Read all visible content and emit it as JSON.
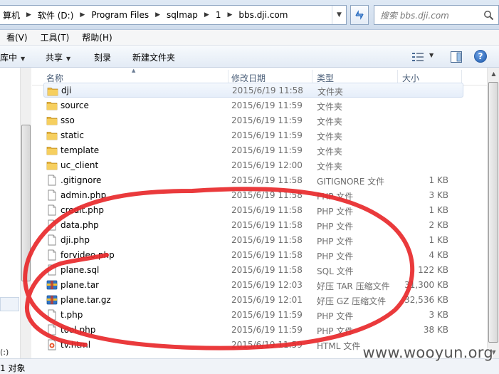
{
  "address": {
    "crumbs": [
      "算机",
      "软件 (D:)",
      "Program Files",
      "sqlmap",
      "1",
      "bbs.dji.com"
    ],
    "search_placeholder": "搜索 bbs.dji.com"
  },
  "menu": [
    "看(V)",
    "工具(T)",
    "帮助(H)"
  ],
  "toolbar": {
    "library_label": "库中",
    "share_label": "共享",
    "burn_label": "刻录",
    "new_folder_label": "新建文件夹",
    "help_label": "?"
  },
  "columns": {
    "name": "名称",
    "date": "修改日期",
    "type": "类型",
    "size": "大小"
  },
  "files": [
    {
      "name": "dji",
      "date": "2015/6/19 11:58",
      "type": "文件夹",
      "size": "",
      "icon": "folder-icon",
      "selected": true
    },
    {
      "name": "source",
      "date": "2015/6/19 11:59",
      "type": "文件夹",
      "size": "",
      "icon": "folder-icon"
    },
    {
      "name": "sso",
      "date": "2015/6/19 11:59",
      "type": "文件夹",
      "size": "",
      "icon": "folder-icon"
    },
    {
      "name": "static",
      "date": "2015/6/19 11:59",
      "type": "文件夹",
      "size": "",
      "icon": "folder-icon"
    },
    {
      "name": "template",
      "date": "2015/6/19 11:59",
      "type": "文件夹",
      "size": "",
      "icon": "folder-icon"
    },
    {
      "name": "uc_client",
      "date": "2015/6/19 12:00",
      "type": "文件夹",
      "size": "",
      "icon": "folder-icon"
    },
    {
      "name": ".gitignore",
      "date": "2015/6/19 11:58",
      "type": "GITIGNORE 文件",
      "size": "1 KB",
      "icon": "file-icon"
    },
    {
      "name": "admin.php",
      "date": "2015/6/19 11:58",
      "type": "PHP 文件",
      "size": "3 KB",
      "icon": "file-icon"
    },
    {
      "name": "credit.php",
      "date": "2015/6/19 11:58",
      "type": "PHP 文件",
      "size": "1 KB",
      "icon": "file-icon"
    },
    {
      "name": "data.php",
      "date": "2015/6/19 11:58",
      "type": "PHP 文件",
      "size": "2 KB",
      "icon": "file-icon"
    },
    {
      "name": "dji.php",
      "date": "2015/6/19 11:58",
      "type": "PHP 文件",
      "size": "1 KB",
      "icon": "file-icon"
    },
    {
      "name": "forvideo.php",
      "date": "2015/6/19 11:58",
      "type": "PHP 文件",
      "size": "4 KB",
      "icon": "file-icon"
    },
    {
      "name": "plane.sql",
      "date": "2015/6/19 11:58",
      "type": "SQL 文件",
      "size": "122 KB",
      "icon": "file-icon"
    },
    {
      "name": "plane.tar",
      "date": "2015/6/19 12:03",
      "type": "好压 TAR 压缩文件",
      "size": "31,300 KB",
      "icon": "archive-icon"
    },
    {
      "name": "plane.tar.gz",
      "date": "2015/6/19 12:01",
      "type": "好压 GZ 压缩文件",
      "size": "32,536 KB",
      "icon": "archive-icon"
    },
    {
      "name": "t.php",
      "date": "2015/6/19 11:59",
      "type": "PHP 文件",
      "size": "3 KB",
      "icon": "file-icon"
    },
    {
      "name": "tool.php",
      "date": "2015/6/19 11:59",
      "type": "PHP 文件",
      "size": "38 KB",
      "icon": "file-icon"
    },
    {
      "name": "tv.html",
      "date": "2015/6/19 11:59",
      "type": "HTML 文件",
      "size": "",
      "icon": "html-icon"
    }
  ],
  "status": {
    "text": "1 对象",
    "nav_text": "(:)"
  },
  "watermark": "www.wooyun.org"
}
